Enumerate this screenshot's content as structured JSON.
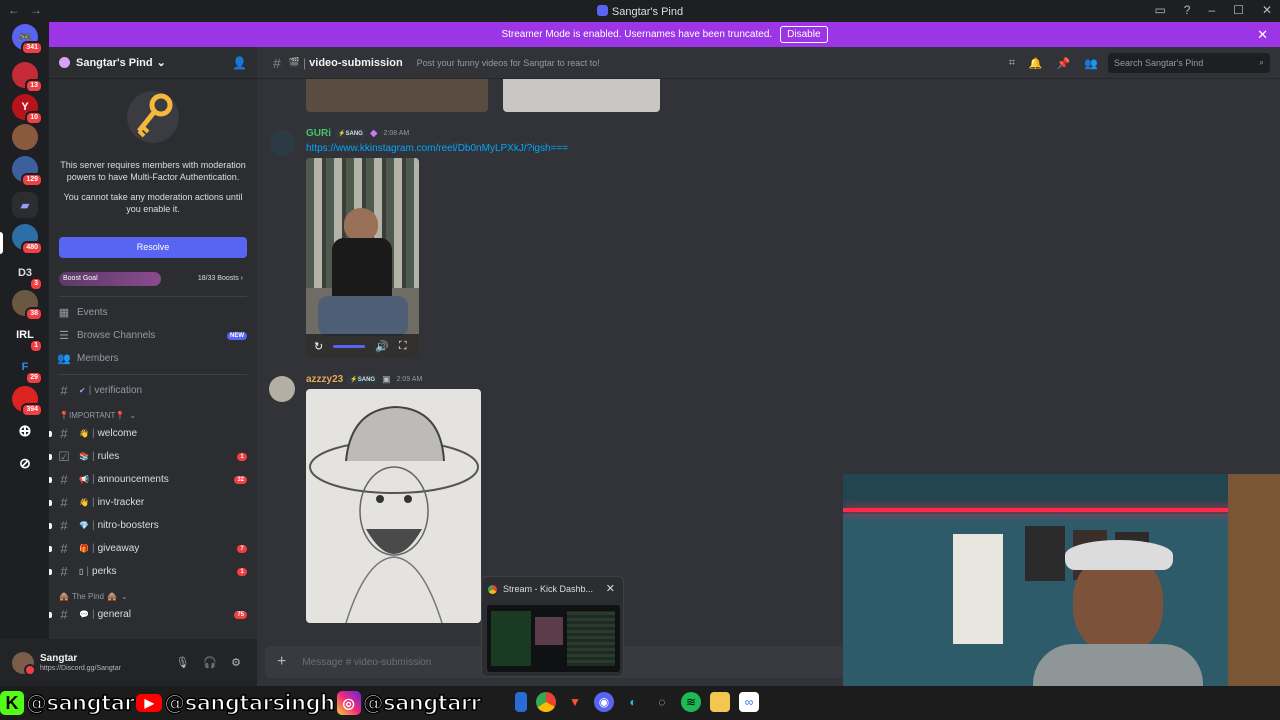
{
  "window": {
    "title": "Sangtar's Pind"
  },
  "banner": {
    "text": "Streamer Mode is enabled. Usernames have been truncated.",
    "button": "Disable"
  },
  "guilds": [
    {
      "badge": "341"
    },
    {
      "badge": "13"
    },
    {
      "badge": "10"
    },
    {
      "badge": ""
    },
    {
      "badge": "129"
    },
    {
      "badge": ""
    },
    {
      "badge": "480"
    },
    {
      "label": "D3",
      "badge": "3"
    },
    {
      "badge": "38"
    },
    {
      "label": "IRL",
      "badge": "1"
    },
    {
      "badge": "29"
    },
    {
      "badge": "394"
    }
  ],
  "server": {
    "name": "Sangtar's Pind"
  },
  "mfa": {
    "line1": "This server requires members with moderation powers to have Multi-Factor Authentication.",
    "line2": "You cannot take any moderation actions until you enable it.",
    "resolve": "Resolve"
  },
  "boost": {
    "label": "Boost Goal",
    "count": "18/33 Boosts",
    "progress": 0.545
  },
  "nav": {
    "events": "Events",
    "browse": "Browse Channels",
    "new": "NEW",
    "members": "Members"
  },
  "channels": {
    "verification": "verification",
    "cat_important": "IMPORTANT",
    "welcome": "welcome",
    "rules": "rules",
    "rules_count": "1",
    "announcements": "announcements",
    "announcements_count": "32",
    "inv_tracker": "inv-tracker",
    "nitro": "nitro-boosters",
    "giveaway": "giveaway",
    "giveaway_count": "7",
    "perks": "perks",
    "perks_count": "1",
    "cat_pind": "The Pind",
    "general": "general",
    "general_count": "75"
  },
  "user": {
    "name": "Sangtar",
    "sub": "https://Discord.gg/Sangtar"
  },
  "channel_header": {
    "name": "video-submission",
    "topic": "Post your funny videos for Sangtar to react to!",
    "search": "Search Sangtar's Pind"
  },
  "messages": [
    {
      "author": "GURi",
      "tag": "SANG",
      "time": "2:08 AM",
      "link": "https://www.kkinstagram.com/reel/Db0nMyLPXkJ/?igsh==="
    },
    {
      "author": "azzzy23",
      "tag": "SANG",
      "time": "2:09 AM"
    }
  ],
  "composer": {
    "placeholder": "Message # video-submission"
  },
  "stream_popup": {
    "title": "Stream - Kick Dashb..."
  },
  "overlay": {
    "handle1": "@sangtar",
    "handle2": "@sangtarsingh",
    "handle3": "@sangtarr"
  },
  "colors": {
    "accent": "#5865f2",
    "banner": "#9b35e6",
    "mention": "#f23f43",
    "link": "#00a8fc"
  }
}
